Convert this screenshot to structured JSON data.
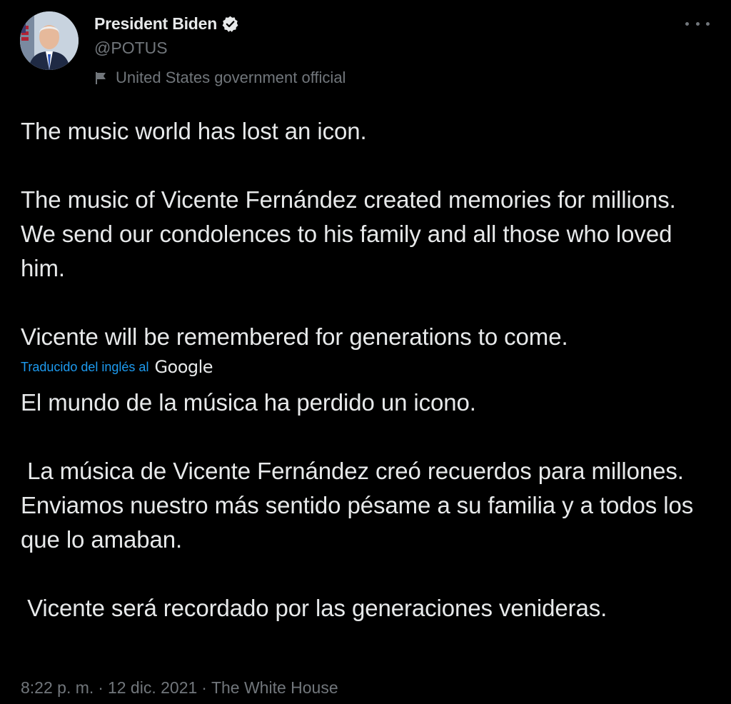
{
  "author": {
    "display_name": "President Biden",
    "handle": "@POTUS",
    "label": "United States government official",
    "verified": true,
    "avatar_icon": "avatar-photo"
  },
  "tweet": {
    "text": "The music world has lost an icon.\n\nThe music of Vicente Fernández created memories for millions. We send our condolences to his family and all those who loved him.\n\nVicente will be remembered for generations to come.",
    "translated_from_label": "Traducido del inglés al",
    "translation_provider": "Google",
    "translated_text": "El mundo de la música ha perdido un icono.\n\n La música de Vicente Fernández creó recuerdos para millones. Enviamos nuestro más sentido pésame a su familia y a todos los que lo amaban.\n\n Vicente será recordado por las generaciones venideras.",
    "time": "8:22 p. m.",
    "separator": "·",
    "date": "12 dic. 2021",
    "source": "The White House"
  },
  "colors": {
    "background": "#000000",
    "text_primary": "#e7e9ea",
    "text_secondary": "#71767b",
    "accent": "#1d9bf0"
  },
  "icons": {
    "more": "more-horizontal-icon",
    "verified": "verified-badge-icon",
    "label": "flag-icon"
  }
}
